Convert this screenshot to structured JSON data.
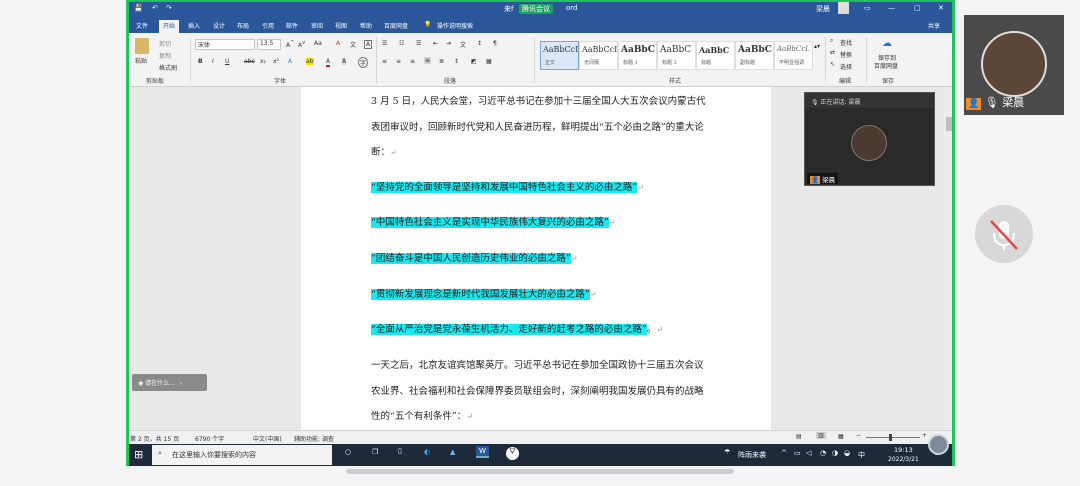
{
  "app": {
    "title_left": "来f",
    "title_badge": "腾讯会议",
    "title_right": "ord",
    "user": "梁晨",
    "share": "共享"
  },
  "ribbon_tabs": [
    "文件",
    "开始",
    "插入",
    "设计",
    "布局",
    "引用",
    "邮件",
    "审阅",
    "视图",
    "帮助",
    "百度网盘",
    "操作说明搜索"
  ],
  "clipboard": {
    "paste": "粘贴",
    "cut": "剪切",
    "copy": "复制",
    "painter": "格式刷",
    "group": "剪贴板"
  },
  "font": {
    "name": "宋体",
    "size": "13.5",
    "group": "字体"
  },
  "paragraph": {
    "group": "段落"
  },
  "styles": {
    "group": "样式",
    "items": [
      {
        "preview": "AaBbCcI",
        "name": "正文"
      },
      {
        "preview": "AaBbCcI",
        "name": "无间隔"
      },
      {
        "preview": "AaBbC",
        "name": "标题 1"
      },
      {
        "preview": "AaBbC",
        "name": "标题 2"
      },
      {
        "preview": "AaBbC",
        "name": "标题"
      },
      {
        "preview": "AaBbC",
        "name": "副标题"
      },
      {
        "preview": "AaBbCcL",
        "name": "不明显强调"
      }
    ]
  },
  "editing": {
    "find": "查找",
    "replace": "替换",
    "select": "选择",
    "group": "编辑"
  },
  "save": {
    "label1": "保存到",
    "label2": "百度网盘",
    "group": "保存"
  },
  "document": {
    "p1": "3 月 5 日，人民大会堂，习近平总书记在参加十三届全国人大五次会议内蒙古代表团审议时，回顾新时代党和人民奋进历程，鲜明提出“五个必由之路”的重大论断：",
    "items": [
      "“坚持党的全面领导是坚持和发展中国特色社会主义的必由之路”",
      "“中国特色社会主义是实现中华民族伟大复兴的必由之路”",
      "“团结奋斗是中国人民创造历史伟业的必由之路”",
      "“贯彻新发展理念是新时代我国发展壮大的必由之路”",
      "“全面从严治党是党永葆生机活力、走好新的赶考之路的必由之路”"
    ],
    "item_suffix": "。",
    "p2": "一天之后，北京友谊宾馆聚英厅。习近平总书记在参加全国政协十三届五次会议农业界、社会福利和社会保障界委员联组会时，深刻阐明我国发展仍具有的战略性的“五个有利条件”：",
    "para_mark": "↵"
  },
  "status": {
    "page": "第 2 页，共 15 页",
    "words": "6790 个字",
    "lang": "中文(中国)",
    "access": "辅助功能: 调查"
  },
  "taskbar": {
    "search": "在这里输入你要搜索的内容",
    "weather": "阵雨来袭",
    "ime": "中",
    "time": "19:13",
    "date": "2022/3/21"
  },
  "meeting": {
    "speaking": "正在讲话: 梁晨",
    "participant": "梁晨",
    "side_name": "梁晨",
    "floating_tip": "请在什么..."
  }
}
